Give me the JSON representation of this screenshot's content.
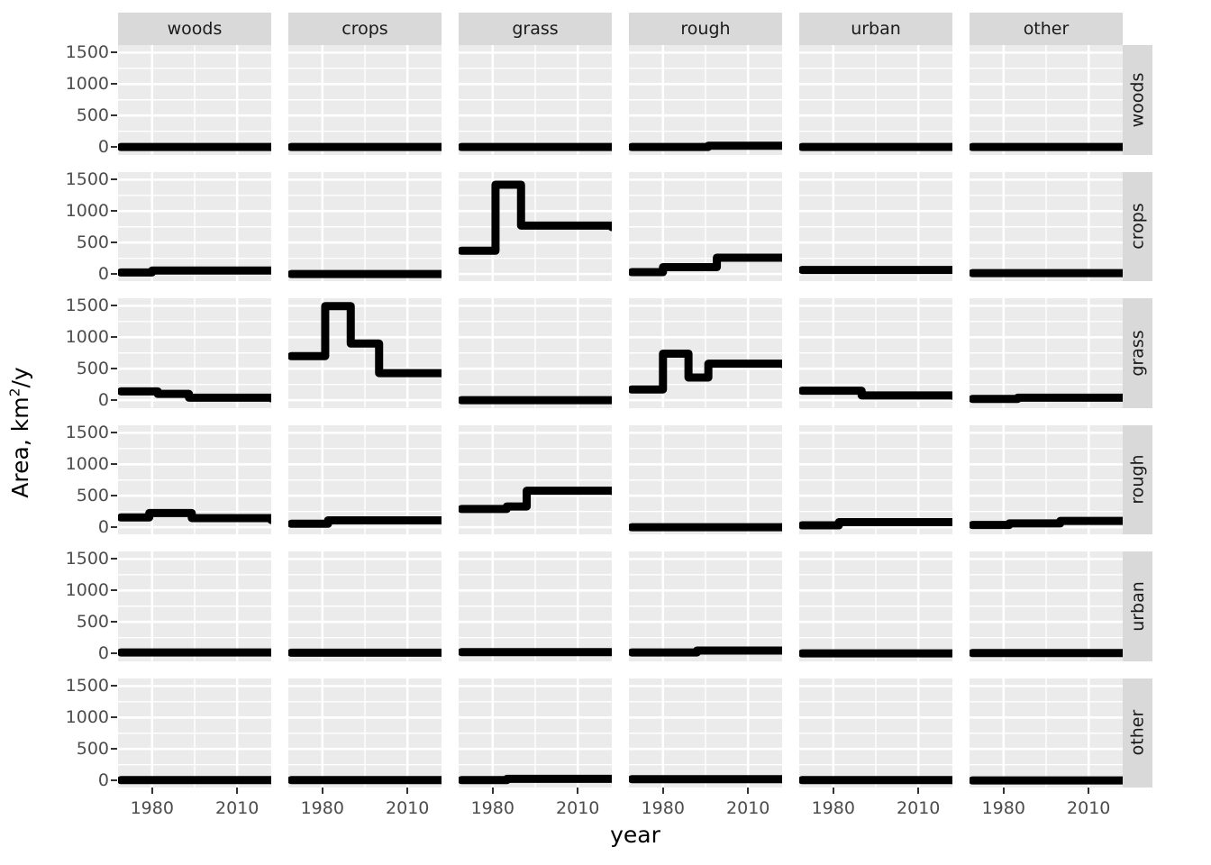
{
  "chart_data": {
    "type": "line",
    "title": "",
    "subtitle": "",
    "xlabel": "year",
    "ylabel_parts": {
      "prefix": "Area, km",
      "exponent": "2",
      "suffix": "/y"
    },
    "ylabel": "Area, km2/y",
    "xlim": [
      1968,
      2022
    ],
    "ylim": [
      -120,
      1620
    ],
    "xticks": [
      1980,
      2010
    ],
    "yticks": [
      0,
      500,
      1000,
      1500
    ],
    "grid": true,
    "legend_position": "none",
    "facet_style": "grid",
    "facet_note": "rows = source land-use class (right strips), columns = target land-use class (top strips)",
    "col_facets": [
      "woods",
      "crops",
      "grass",
      "rough",
      "urban",
      "other"
    ],
    "row_facets": [
      "woods",
      "crops",
      "grass",
      "rough",
      "urban",
      "other"
    ],
    "line_color": "#000000",
    "line_width": 9,
    "panel_fill": "#ebebeb",
    "strip_fill": "#d9d9d9",
    "grid_color": "#ffffff",
    "step_series": [
      {
        "row": "woods",
        "col": "woods",
        "x": [
          1969,
          2022
        ],
        "y": [
          0,
          0
        ]
      },
      {
        "row": "woods",
        "col": "crops",
        "x": [
          1969,
          2022
        ],
        "y": [
          0,
          0
        ]
      },
      {
        "row": "woods",
        "col": "grass",
        "x": [
          1969,
          2022
        ],
        "y": [
          0,
          0
        ]
      },
      {
        "row": "woods",
        "col": "rough",
        "x": [
          1969,
          1996,
          2022
        ],
        "y": [
          0,
          20,
          20
        ]
      },
      {
        "row": "woods",
        "col": "urban",
        "x": [
          1969,
          2022
        ],
        "y": [
          0,
          0
        ]
      },
      {
        "row": "woods",
        "col": "other",
        "x": [
          1969,
          2022
        ],
        "y": [
          0,
          0
        ]
      },
      {
        "row": "crops",
        "col": "woods",
        "x": [
          1969,
          1980,
          2022
        ],
        "y": [
          25,
          55,
          55
        ]
      },
      {
        "row": "crops",
        "col": "crops",
        "x": [
          1969,
          2022
        ],
        "y": [
          0,
          0
        ]
      },
      {
        "row": "crops",
        "col": "grass",
        "x": [
          1969,
          1981,
          1990,
          2022
        ],
        "y": [
          370,
          1420,
          770,
          745
        ]
      },
      {
        "row": "crops",
        "col": "rough",
        "x": [
          1969,
          1980,
          1990,
          1999,
          2022
        ],
        "y": [
          30,
          110,
          110,
          260,
          260
        ]
      },
      {
        "row": "crops",
        "col": "urban",
        "x": [
          1969,
          2022
        ],
        "y": [
          65,
          65
        ]
      },
      {
        "row": "crops",
        "col": "other",
        "x": [
          1969,
          2022
        ],
        "y": [
          15,
          15
        ]
      },
      {
        "row": "grass",
        "col": "woods",
        "x": [
          1969,
          1982,
          1993,
          2022
        ],
        "y": [
          140,
          100,
          40,
          30
        ]
      },
      {
        "row": "grass",
        "col": "crops",
        "x": [
          1969,
          1981,
          1990,
          2000,
          2022
        ],
        "y": [
          700,
          1495,
          900,
          430,
          430
        ]
      },
      {
        "row": "grass",
        "col": "grass",
        "x": [
          1969,
          2022
        ],
        "y": [
          0,
          0
        ]
      },
      {
        "row": "grass",
        "col": "rough",
        "x": [
          1969,
          1980,
          1989,
          1996,
          2022
        ],
        "y": [
          170,
          740,
          360,
          580,
          575
        ]
      },
      {
        "row": "grass",
        "col": "urban",
        "x": [
          1969,
          1990,
          2022
        ],
        "y": [
          150,
          75,
          70
        ]
      },
      {
        "row": "grass",
        "col": "other",
        "x": [
          1969,
          1985,
          2022
        ],
        "y": [
          20,
          40,
          40
        ]
      },
      {
        "row": "rough",
        "col": "woods",
        "x": [
          1969,
          1979,
          1994,
          2022
        ],
        "y": [
          155,
          225,
          145,
          115
        ]
      },
      {
        "row": "rough",
        "col": "crops",
        "x": [
          1969,
          1982,
          2022
        ],
        "y": [
          55,
          110,
          110
        ]
      },
      {
        "row": "rough",
        "col": "grass",
        "x": [
          1969,
          1985,
          1992,
          2022
        ],
        "y": [
          290,
          330,
          580,
          575
        ]
      },
      {
        "row": "rough",
        "col": "rough",
        "x": [
          1969,
          2022
        ],
        "y": [
          0,
          0
        ]
      },
      {
        "row": "rough",
        "col": "urban",
        "x": [
          1969,
          1982,
          2022
        ],
        "y": [
          30,
          80,
          80
        ]
      },
      {
        "row": "rough",
        "col": "other",
        "x": [
          1969,
          1982,
          2000,
          2022
        ],
        "y": [
          35,
          60,
          100,
          100
        ]
      },
      {
        "row": "urban",
        "col": "woods",
        "x": [
          1969,
          2022
        ],
        "y": [
          15,
          15
        ]
      },
      {
        "row": "urban",
        "col": "crops",
        "x": [
          1969,
          2022
        ],
        "y": [
          10,
          10
        ]
      },
      {
        "row": "urban",
        "col": "grass",
        "x": [
          1969,
          2022
        ],
        "y": [
          20,
          20
        ]
      },
      {
        "row": "urban",
        "col": "rough",
        "x": [
          1969,
          1992,
          2022
        ],
        "y": [
          15,
          45,
          45
        ]
      },
      {
        "row": "urban",
        "col": "urban",
        "x": [
          1969,
          2022
        ],
        "y": [
          0,
          0
        ]
      },
      {
        "row": "urban",
        "col": "other",
        "x": [
          1969,
          2022
        ],
        "y": [
          5,
          5
        ]
      },
      {
        "row": "other",
        "col": "woods",
        "x": [
          1969,
          2022
        ],
        "y": [
          5,
          5
        ]
      },
      {
        "row": "other",
        "col": "crops",
        "x": [
          1969,
          2022
        ],
        "y": [
          5,
          5
        ]
      },
      {
        "row": "other",
        "col": "grass",
        "x": [
          1969,
          1985,
          2022
        ],
        "y": [
          5,
          25,
          25
        ]
      },
      {
        "row": "other",
        "col": "rough",
        "x": [
          1969,
          2022
        ],
        "y": [
          20,
          20
        ]
      },
      {
        "row": "other",
        "col": "urban",
        "x": [
          1969,
          2022
        ],
        "y": [
          5,
          5
        ]
      },
      {
        "row": "other",
        "col": "other",
        "x": [
          1969,
          2022
        ],
        "y": [
          0,
          0
        ]
      }
    ]
  }
}
